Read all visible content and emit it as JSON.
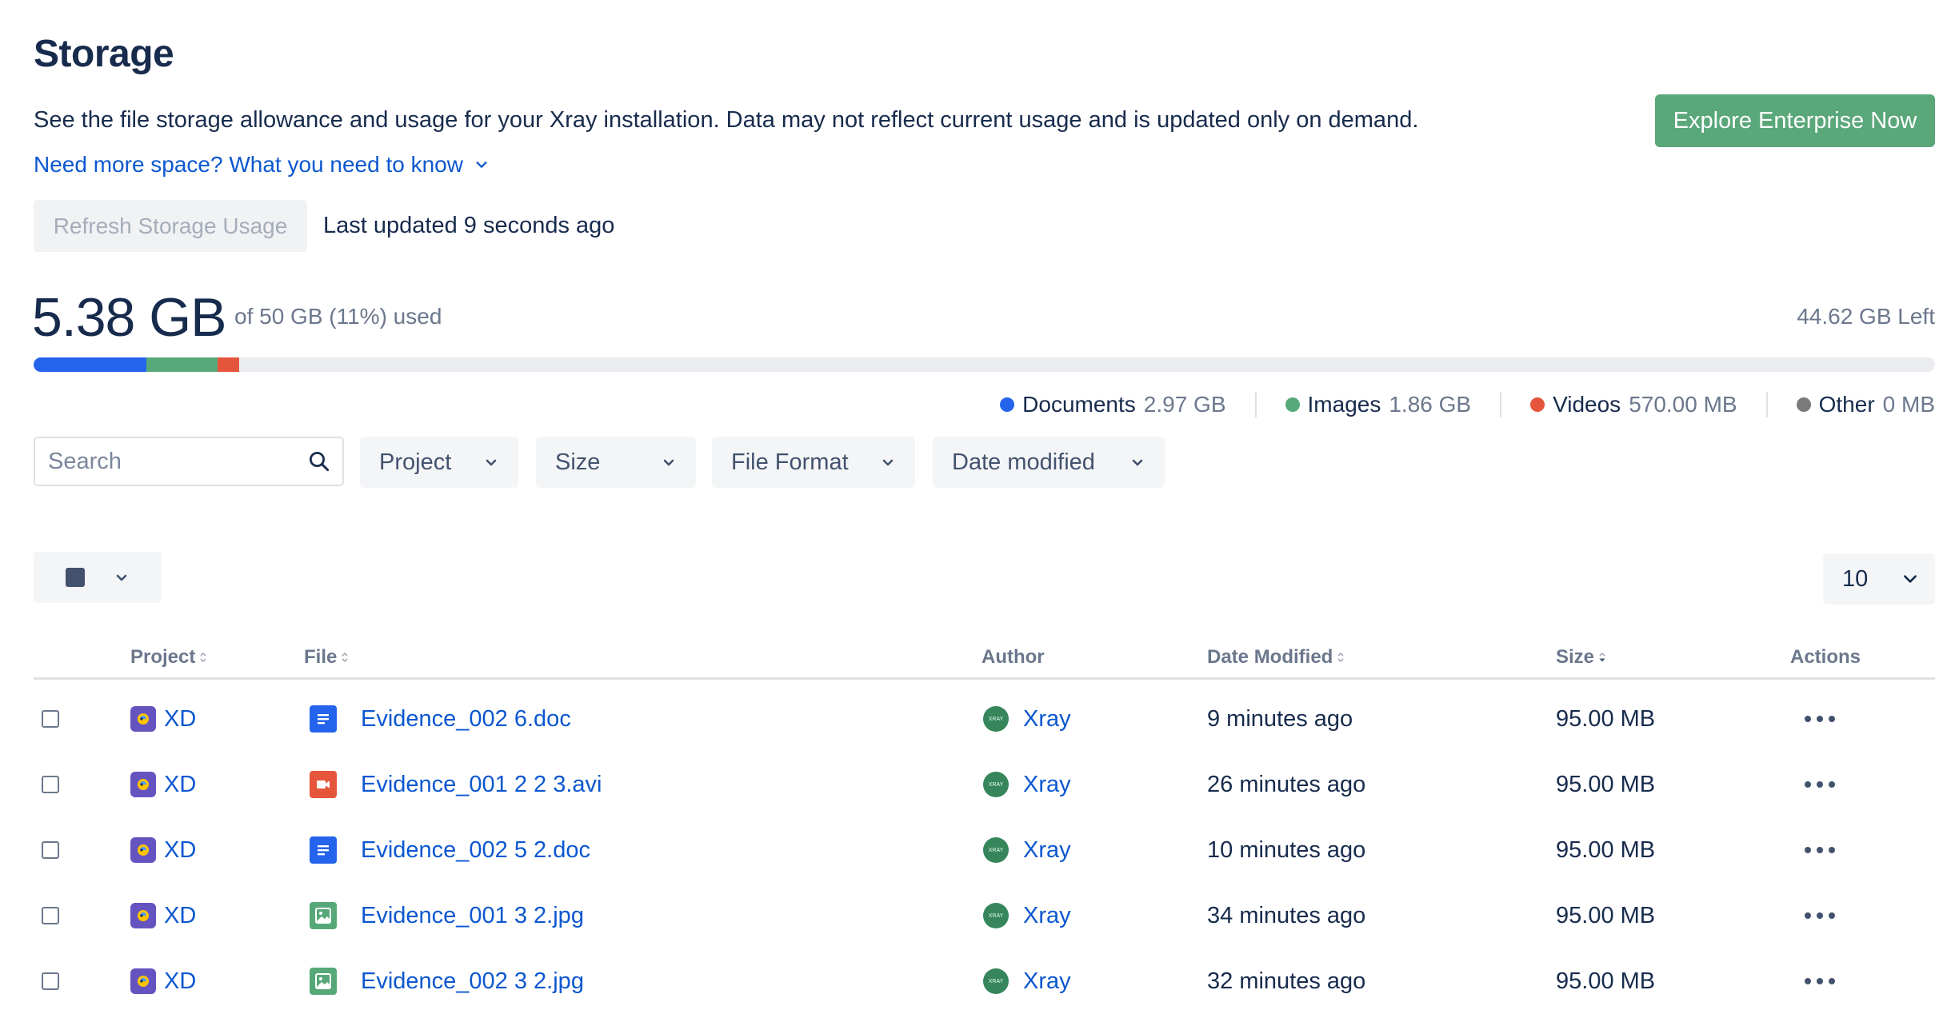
{
  "header": {
    "title": "Storage",
    "description": "See the file storage allowance and usage for your Xray installation. Data may not reflect current usage and is updated only on demand.",
    "more_link": "Need more space? What you need to know",
    "cta": "Explore Enterprise Now",
    "refresh_label": "Refresh Storage Usage",
    "last_updated": "Last updated 9 seconds ago"
  },
  "usage": {
    "used": "5.38 GB",
    "of_total": "of 50 GB (11%) used",
    "left": "44.62 GB Left",
    "used_fraction": 0.1076,
    "segments": [
      {
        "name": "documents",
        "fraction": 0.0594,
        "color": "#2463eb"
      },
      {
        "name": "images",
        "fraction": 0.0372,
        "color": "#57a879"
      },
      {
        "name": "videos",
        "fraction": 0.0114,
        "color": "#e5553b"
      }
    ]
  },
  "legend": [
    {
      "label": "Documents",
      "value": "2.97 GB",
      "color": "#2463eb"
    },
    {
      "label": "Images",
      "value": "1.86 GB",
      "color": "#57a879"
    },
    {
      "label": "Videos",
      "value": "570.00 MB",
      "color": "#e5553b"
    },
    {
      "label": "Other",
      "value": "0 MB",
      "color": "#7a7a7a"
    }
  ],
  "filters": {
    "search_placeholder": "Search",
    "project": "Project",
    "size": "Size",
    "file_format": "File Format",
    "date_modified": "Date modified"
  },
  "table": {
    "per_page": "10",
    "headers": {
      "project": "Project",
      "file": "File",
      "author": "Author",
      "date_modified": "Date Modified",
      "size": "Size",
      "actions": "Actions"
    },
    "rows": [
      {
        "project": "XD",
        "file": "Evidence_002 6.doc",
        "type": "doc",
        "author": "Xray",
        "avatar": "XRAY",
        "date": "9 minutes ago",
        "size": "95.00 MB"
      },
      {
        "project": "XD",
        "file": "Evidence_001 2 2 3.avi",
        "type": "video",
        "author": "Xray",
        "avatar": "XRAY",
        "date": "26 minutes ago",
        "size": "95.00 MB"
      },
      {
        "project": "XD",
        "file": "Evidence_002 5 2.doc",
        "type": "doc",
        "author": "Xray",
        "avatar": "XRAY",
        "date": "10 minutes ago",
        "size": "95.00 MB"
      },
      {
        "project": "XD",
        "file": "Evidence_001 3 2.jpg",
        "type": "image",
        "author": "Xray",
        "avatar": "XRAY",
        "date": "34 minutes ago",
        "size": "95.00 MB"
      },
      {
        "project": "XD",
        "file": "Evidence_002 3 2.jpg",
        "type": "image",
        "author": "Xray",
        "avatar": "XRAY",
        "date": "32 minutes ago",
        "size": "95.00 MB"
      }
    ]
  }
}
